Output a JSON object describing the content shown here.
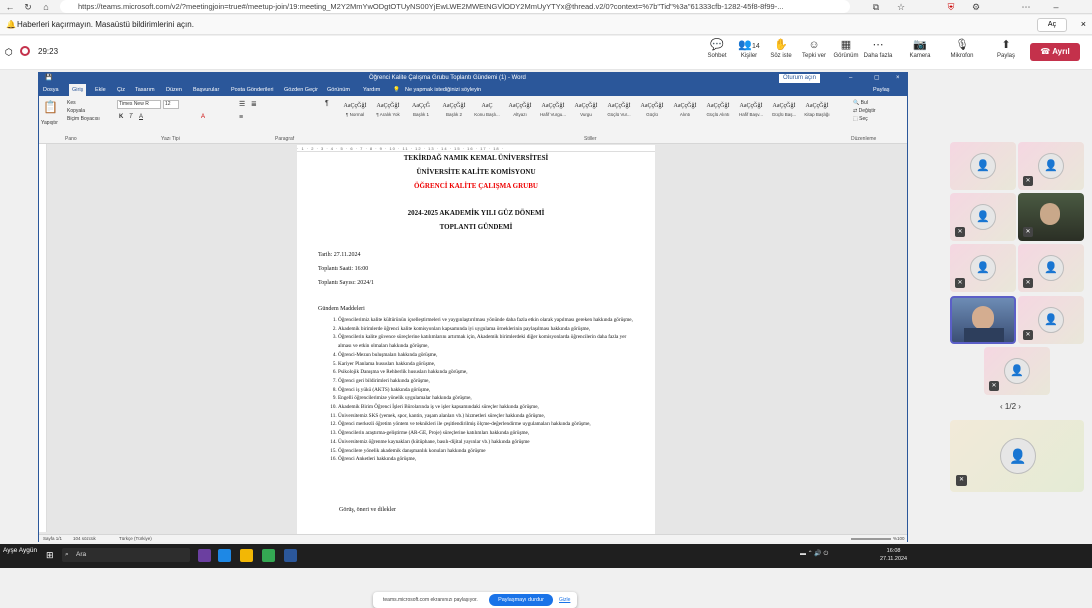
{
  "browser": {
    "url": "https://teams.microsoft.com/v2/?meetingjoin=true#/meetup-join/19:meeting_M2Y2MmYwODgtOTUyNS00YjEwLWE2MWEtNGVlODY2MmUyYTYx@thread.v2/0?context=%7b\"Tid\"%3a\"61333cfb-1282-45f8-8f99-..."
  },
  "notification": {
    "text": "Haberleri kaçırmayın. Masaüstü bildirimlerini açın.",
    "accept_label": "Aç"
  },
  "teams": {
    "timer": "29:23",
    "buttons": {
      "chat": "Sohbet",
      "people": "Kişiler",
      "people_count": "14",
      "raise": "Söz iste",
      "react": "Tepki ver",
      "view": "Görünüm",
      "more": "Daha fazla",
      "camera": "Kamera",
      "mic": "Mikrofon",
      "share": "Paylaş"
    },
    "leave_label": "Ayrıl"
  },
  "word": {
    "title": "Öğrenci Kalite Çalışma Grubu Toplantı Gündemi (1) - Word",
    "signin": "Oturum açın",
    "menu": [
      "Dosya",
      "Giriş",
      "Ekle",
      "Çiz",
      "Tasarım",
      "Düzen",
      "Başvurular",
      "Posta Gönderileri",
      "Gözden Geçir",
      "Görünüm",
      "Yardım"
    ],
    "tell_me": "Ne yapmak istediğinizi söyleyin",
    "share": "Paylaş",
    "font_name": "Times New R",
    "font_size": "12",
    "paste": "Yapıştır",
    "cut": "Kes",
    "copy": "Kopyala",
    "format_painter": "Biçim Boyacısı",
    "groups": [
      "Pano",
      "Yazı Tipi",
      "Paragraf",
      "Stiller",
      "Düzenleme"
    ],
    "styles": [
      {
        "sample": "AaÇçĞğİ",
        "name": "¶ Normal"
      },
      {
        "sample": "AaÇçĞğİ",
        "name": "¶ Aralık Yok"
      },
      {
        "sample": "AaÇçĞ",
        "name": "Başlık 1"
      },
      {
        "sample": "AaÇçĞğİ",
        "name": "Başlık 2"
      },
      {
        "sample": "AaÇ",
        "name": "Konu Başlı..."
      },
      {
        "sample": "AaÇçĞğİ",
        "name": "Altyazı"
      },
      {
        "sample": "AaÇçĞğİ",
        "name": "Hafif Vurgu..."
      },
      {
        "sample": "AaÇçĞğİ",
        "name": "Vurgu"
      },
      {
        "sample": "AaÇçĞğİ",
        "name": "Güçlü Vur..."
      },
      {
        "sample": "AaÇçĞğİ",
        "name": "Güçlü"
      },
      {
        "sample": "AaÇçĞğİ",
        "name": "Alıntı"
      },
      {
        "sample": "AaÇçĞğİ",
        "name": "Güçlü Alıntı"
      },
      {
        "sample": "AaÇçĞğİ",
        "name": "Hafif Başv..."
      },
      {
        "sample": "AaÇçĞğİ",
        "name": "Güçlü Baş..."
      },
      {
        "sample": "AaÇçĞğİ",
        "name": "Kitap Başlığı"
      }
    ],
    "editing": {
      "find": "Bul",
      "replace": "Değiştir",
      "select": "Seç"
    },
    "status": {
      "page": "Sayfa 1/1",
      "words": "104 sözcük",
      "lang": "Türkçe (Türkiye)",
      "zoom": "%100"
    }
  },
  "document": {
    "university": "TEKİRDAĞ NAMIK KEMAL ÜNİVERSİTESİ",
    "commission": "ÜNİVERSİTE KALİTE KOMİSYONU",
    "group": "ÖĞRENCİ KALİTE ÇALIŞMA GRUBU",
    "term": "2024-2025 AKADEMİK YILI GÜZ DÖNEMİ",
    "agenda_title": "TOPLANTI GÜNDEMİ",
    "date": "Tarih: 27.11.2024",
    "time": "Toplantı Saati: 16:00",
    "number": "Toplantı Sayısı: 2024/1",
    "items_title": "Gündem Maddeleri",
    "items": [
      "Öğrencilerimiz kalite kültürünün içselleştirmeleri ve yaygınlaştırılması yönünde daha fazla etkin olarak yapılması gereken hakkında görüşme,",
      "Akademik birimlerde öğrenci kalite komisyonları kapsamında iyi uygulama örneklerinin paylaşılması hakkında görüşme,",
      "Öğrencilerin kalite güvence süreçlerine katılımlarını artırmak için, Akademik birimlerdeki diğer komisyonlarda öğrencilerin daha fazla yer alması ve etkin olmaları hakkında görüşme,",
      "Öğrenci-Mezun buluşmaları hakkında görüşme,",
      "Kariyer Planlama hususları hakkında görüşme,",
      "Psikolojik Danışma ve Rehberlik hususları hakkında görüşme,",
      "Öğrenci geri bildirimleri hakkında görüşme,",
      "Öğrenci iş yükü (AKTS) hakkında görüşme,",
      "Engelli öğrencilerimize yönelik uygulamalar hakkında görüşme,",
      "Akademik Birim Öğrenci İşleri Bürolarında iş ve işler kapsamındaki süreçler hakkında görüşme,",
      "Üniversitemiz SKS (yemek, spor, kantin, yaşam alanları vb.) hizmetleri süreçler hakkında görüşme,",
      "Öğrenci merkezli öğretim yöntem ve teknikleri ile çeşitlendirilmiş ölçme-değerlendirme uygulamaları hakkında görüşme,",
      "Öğrencilerin araştırma-geliştirme (AR-GE, Proje) süreçlerine katılımları hakkında görüşme,",
      "Üniversitemiz öğrenme kaynakları (kütüphane, basılı-dijital yayınlar vb.) hakkında görüşme",
      "Öğrencilere yönelik akademik danışmanlık konuları hakkında görüşme",
      "Öğrenci Anketleri hakkında görüşme,"
    ],
    "closing": "Görüş, öneri ve dilekler"
  },
  "share_bar": {
    "text": "teams.microsoft.com ekranınızı paylaşıyor.",
    "stop": "Paylaşmayı durdur",
    "hide": "Gizle"
  },
  "taskbar": {
    "presenter": "Ayşe Aygün",
    "search": "Ara",
    "time": "16:08",
    "date": "27.11.2024"
  },
  "participants": {
    "pager": "1/2"
  }
}
